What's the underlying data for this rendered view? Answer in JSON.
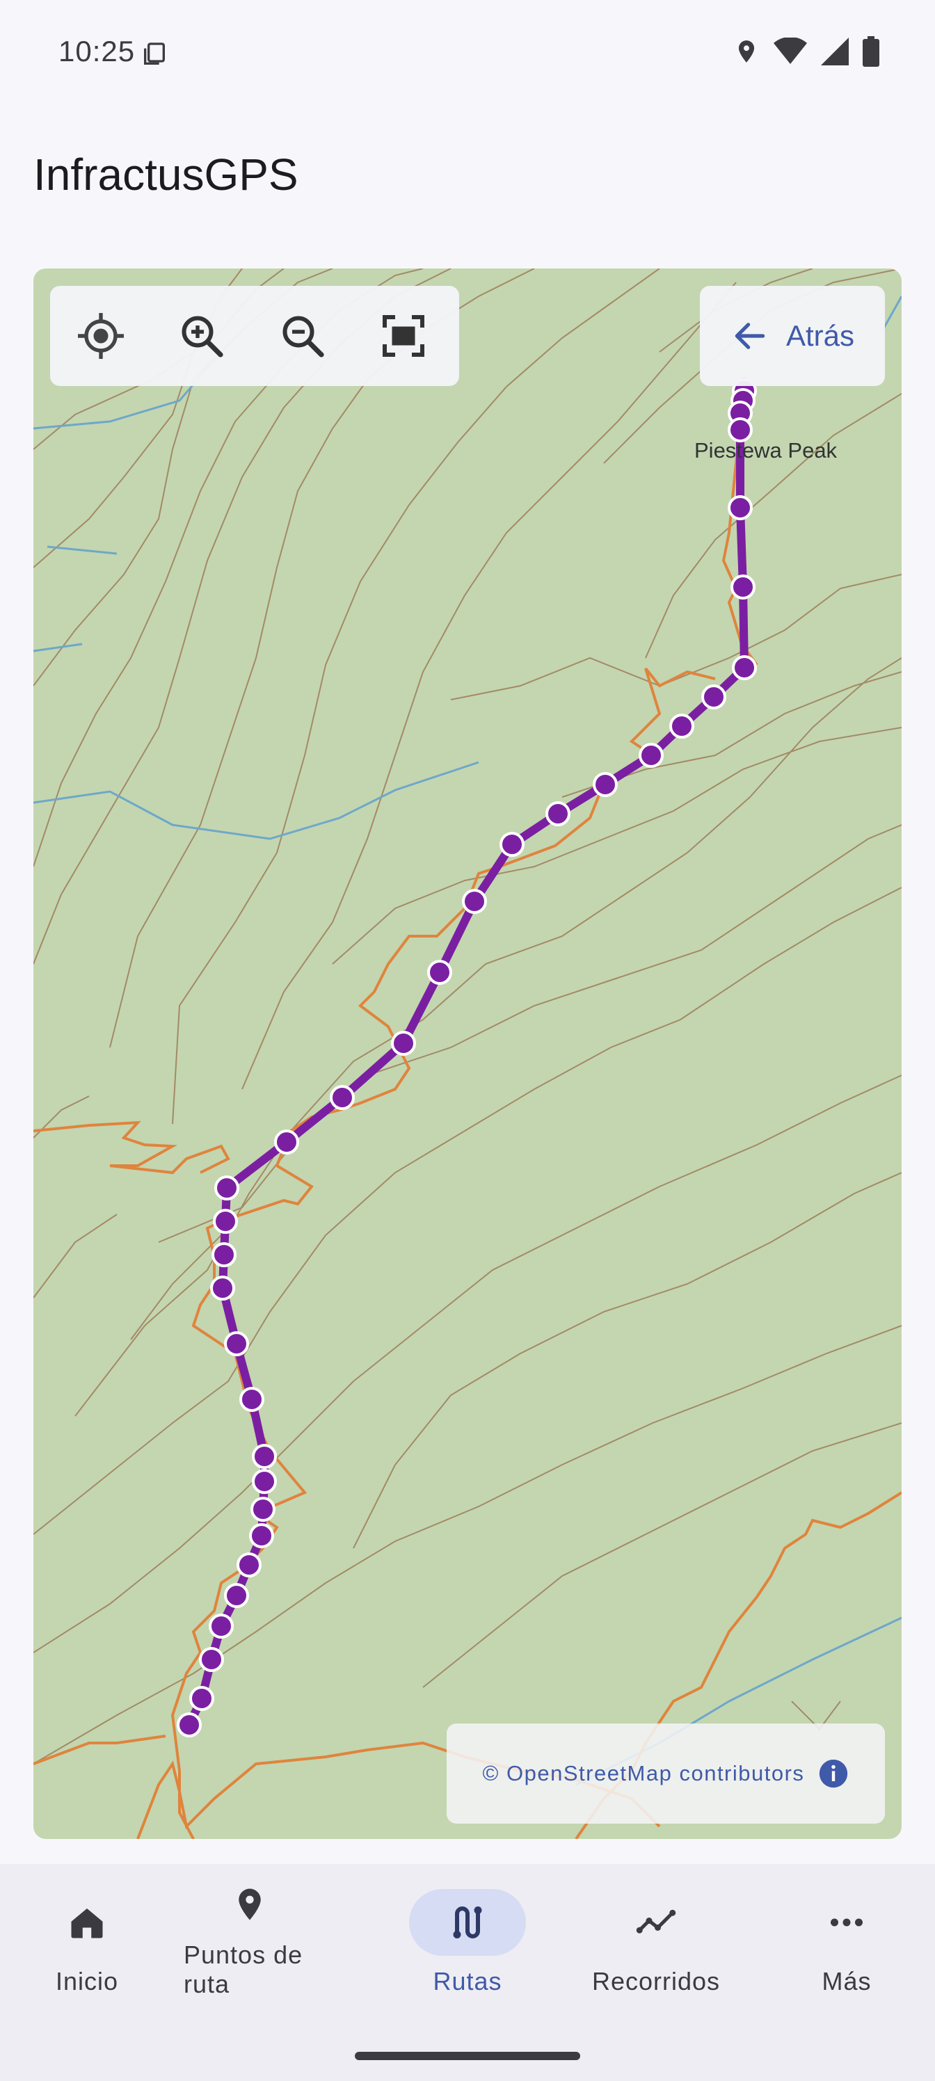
{
  "status_bar": {
    "time": "10:25"
  },
  "app": {
    "title": "InfractusGPS"
  },
  "map": {
    "peak_label": "Piestewa Peak",
    "back_label": "Atrás",
    "attribution": "© OpenStreetMap contributors",
    "route_color": "#7b1fa2",
    "trail_color": "#e0843d"
  },
  "bottom_nav": {
    "items": [
      {
        "label": "Inicio",
        "icon": "home-icon"
      },
      {
        "label": "Puntos de ruta",
        "icon": "location-pin-icon"
      },
      {
        "label": "Rutas",
        "icon": "route-icon",
        "active": true
      },
      {
        "label": "Recorridos",
        "icon": "track-icon"
      },
      {
        "label": "Más",
        "icon": "more-icon"
      }
    ]
  }
}
